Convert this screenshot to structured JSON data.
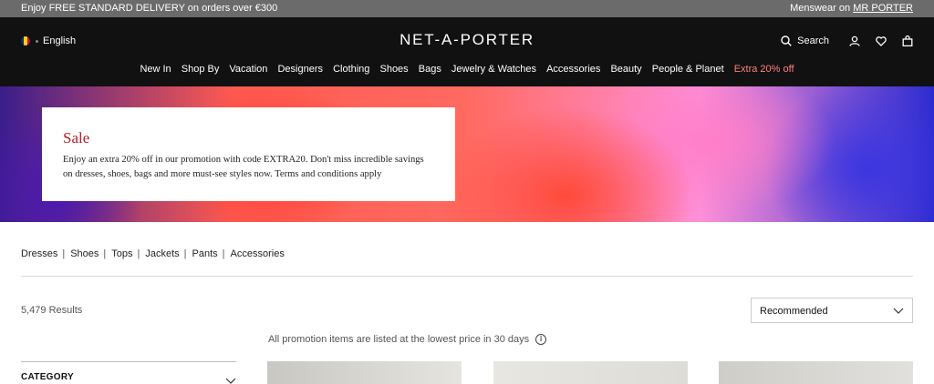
{
  "promo_bar": {
    "left_text": "Enjoy FREE STANDARD DELIVERY on orders over €300",
    "right_prefix": "Menswear on ",
    "right_link": "MR PORTER"
  },
  "header": {
    "language": "English",
    "flag_colors": [
      "#002B7F",
      "#FCD116",
      "#CE1126"
    ],
    "logo": "NET-A-PORTER",
    "search_label": "Search",
    "icons": [
      "search-icon",
      "account-icon",
      "wishlist-icon",
      "bag-icon"
    ]
  },
  "nav": {
    "items": [
      "New In",
      "Shop By",
      "Vacation",
      "Designers",
      "Clothing",
      "Shoes",
      "Bags",
      "Jewelry & Watches",
      "Accessories",
      "Beauty",
      "People & Planet"
    ],
    "accent_item": "Extra 20% off",
    "accent_color": "#ff8080"
  },
  "hero": {
    "title": "Sale",
    "text": "Enjoy an extra 20% off in our promotion with code EXTRA20. Don't miss incredible savings on dresses, shoes, bags and more must-see styles now. Terms and conditions apply",
    "title_color": "#b51e2b"
  },
  "quick_links": [
    "Dresses",
    "Shoes",
    "Tops",
    "Jackets",
    "Pants",
    "Accessories"
  ],
  "listing": {
    "results": "5,479 Results",
    "sort_value": "Recommended",
    "promo_note": "All promotion items are listed at the lowest price in 30 days",
    "filter_label": "CATEGORY"
  }
}
